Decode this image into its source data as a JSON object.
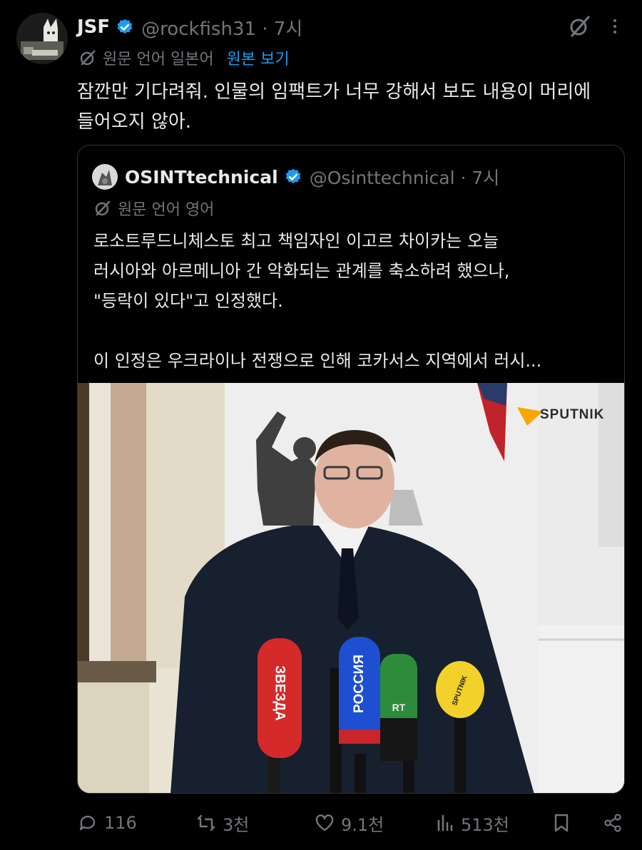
{
  "tweet": {
    "author_name": "JSF",
    "handle": "@rockfish31 · 7시",
    "translation_note": "원문 언어 일본어",
    "view_original": "원본 보기",
    "text": "잠깐만 기다려줘. 인물의 임팩트가 너무 강해서 보도 내용이 머리에\n들어오지 않아."
  },
  "quote": {
    "author_name": "OSINTtechnical",
    "handle": "@Osinttechnical · 7시",
    "translation_note": "원문 언어 영어",
    "text_lines": [
      "로소트루드니체스토 최고 책임자인 이고르 차이카는 오늘",
      "러시아와 아르메니아 간 악화되는 관계를 축소하려 했으나,",
      "\"등락이 있다\"고 인정했다."
    ],
    "text_tail": "이 인정은 우크라이나 전쟁으로 인해 코카서스 지역에서 러시...",
    "image": {
      "logo_text": "SPUTNIK",
      "mic_labels": [
        "ЗВЕЗДА",
        "РОССИЯ",
        "RT",
        "SPUTNIK"
      ]
    }
  },
  "actions": {
    "replies": "116",
    "reposts": "3천",
    "likes": "9.1천",
    "views": "513천"
  },
  "icons": [
    "verified-badge-icon",
    "grok-icon",
    "more-icon",
    "translate-icon",
    "reply-icon",
    "repost-icon",
    "like-icon",
    "views-icon",
    "bookmark-icon",
    "share-icon"
  ],
  "colors": {
    "background": "#000000",
    "text": "#e7e9ea",
    "muted": "#71767b",
    "link": "#1d9bf0",
    "verified": "#1d9bf0",
    "border": "#2f3336"
  }
}
